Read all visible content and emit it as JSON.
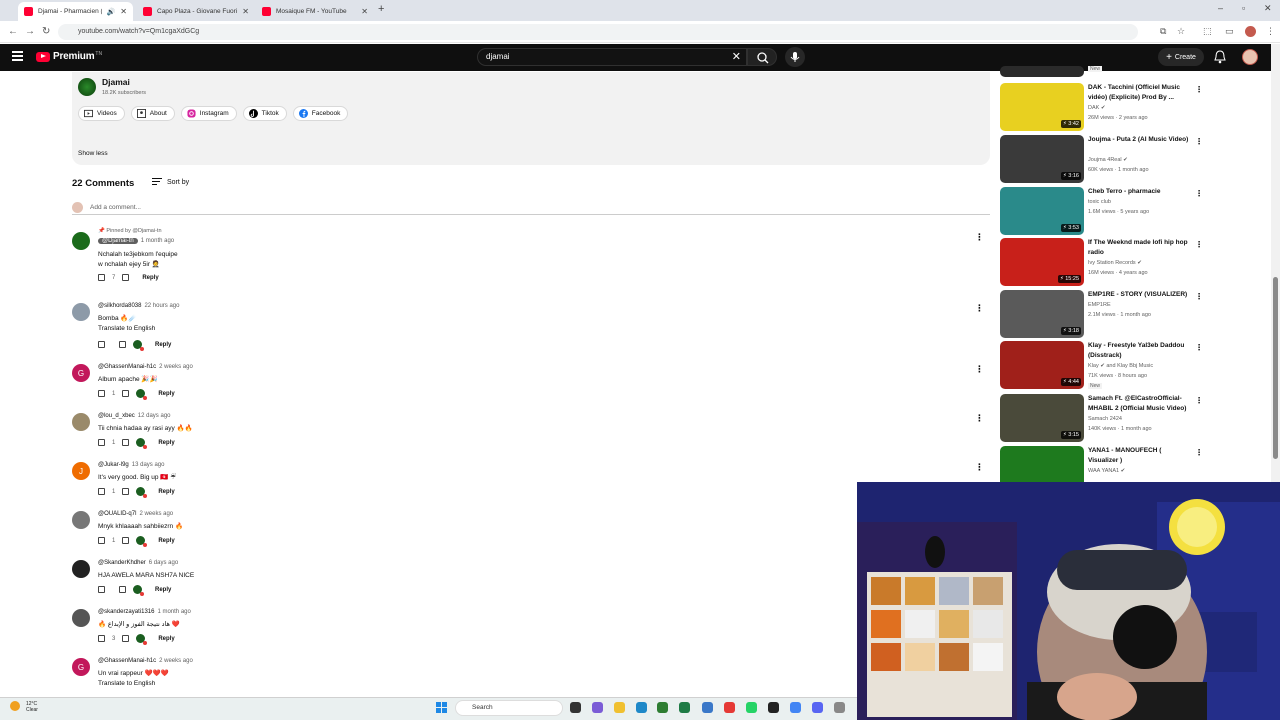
{
  "browser": {
    "tabs": [
      {
        "title": "Djamai - Pharmacien (Lyrics"
      },
      {
        "title": "Capo Plaza - Giovane Fuoriclas"
      },
      {
        "title": "Mosaique FM - YouTube"
      }
    ],
    "url": "youtube.com/watch?v=Qm1cgaXdGCg"
  },
  "header": {
    "logo": "Premium",
    "logo_sup": "TN",
    "search_value": "djamai",
    "create_label": "Create"
  },
  "description": {
    "channel": "Djamai",
    "subscribers": "18.2K subscribers",
    "chips": [
      "Videos",
      "About",
      "Instagram",
      "Tiktok",
      "Facebook"
    ],
    "show_less": "Show less"
  },
  "comments_section": {
    "count_label": "22 Comments",
    "sort_label": "Sort by",
    "add_placeholder": "Add a comment..."
  },
  "comments": [
    {
      "pinned": "Pinned by @Djamai-tn",
      "author": "@Djamai-tn",
      "age": "1 month ago",
      "text": "Nchalah te3jebkom l'equipe\nw nchalah ejey 5ir 🤵",
      "likes": "7",
      "reply": "Reply",
      "avatar": "",
      "avatar_color": "#1b6b1b"
    },
    {
      "author": "@silkhorda8038",
      "age": "22 hours ago",
      "text": "Bomba 🔥☄️",
      "translate": "Translate to English",
      "likes": "",
      "reply": "Reply",
      "avatar": "",
      "avatar_color": "#8d9aa8"
    },
    {
      "author": "@GhassenManai-h1c",
      "age": "2 weeks ago",
      "text": "Album apache 🎉🎉",
      "likes": "1",
      "reply": "Reply",
      "avatar": "G",
      "avatar_color": "#c2185b"
    },
    {
      "author": "@lou_d_xbec",
      "age": "12 days ago",
      "text": "Tii chnia hadaa ay rasi ayy 🔥🔥",
      "likes": "1",
      "reply": "Reply",
      "avatar": "",
      "avatar_color": "#9a8a6a"
    },
    {
      "author": "@Jukar-l9g",
      "age": "13 days ago",
      "text": "It's very good. Big up 🇹🇳 ☔",
      "likes": "1",
      "reply": "Reply",
      "avatar": "J",
      "avatar_color": "#ef6c00"
    },
    {
      "author": "@OUALID-q7l",
      "age": "2 weeks ago",
      "text": "Mnyk khlaaaah sahbiiezrn 🔥",
      "likes": "1",
      "reply": "Reply",
      "avatar": "",
      "avatar_color": "#777"
    },
    {
      "author": "@SkanderKhdher",
      "age": "6 days ago",
      "text": "HJA AWELA MARA NSH7A NICE",
      "likes": "",
      "reply": "Reply",
      "avatar": "",
      "avatar_color": "#222"
    },
    {
      "author": "@skanderzayati1316",
      "age": "1 month ago",
      "text": "🔥 هاد نتيجة الفوز و الإبداع ❤️",
      "likes": "3",
      "reply": "Reply",
      "avatar": "",
      "avatar_color": "#555"
    },
    {
      "author": "@GhassenManai-h1c",
      "age": "2 weeks ago",
      "text": "Un vrai rappeur ❤️❤️❤️",
      "translate": "Translate to English",
      "avatar": "G",
      "avatar_color": "#c2185b"
    }
  ],
  "sidebar": [
    {
      "title": "",
      "channel": "",
      "meta": "",
      "badge": "New",
      "duration": "",
      "thumb": "#2a2a2a"
    },
    {
      "title": "DAK - Tacchini (Officiel Music vidéo) (Explicite) Prod By ...",
      "channel": "DAK ✔",
      "meta": "26M views · 2 years ago",
      "duration": "3:42",
      "thumb": "#e8d020"
    },
    {
      "title": "Joujma - Puta 2 (AI Music Video)",
      "channel": "Joujma 4Real ✔",
      "meta": "60K views · 1 month ago",
      "duration": "3:16",
      "thumb": "#3a3a3a"
    },
    {
      "title": "Cheb Terro - pharmacie",
      "channel": "toxic club",
      "meta": "1.6M views · 5 years ago",
      "duration": "3:53",
      "thumb": "#2a8a8a"
    },
    {
      "title": "If The Weeknd made lofi hip hop radio",
      "channel": "Ivy Station Records ✔",
      "meta": "16M views · 4 years ago",
      "duration": "15:25",
      "thumb": "#c8201a"
    },
    {
      "title": "EMP1RE - STORY (VISUALIZER)",
      "channel": "EMP1RE",
      "meta": "2.1M views · 1 month ago",
      "duration": "3:18",
      "thumb": "#5a5a5a"
    },
    {
      "title": "Klay - Freestyle Yal3eb Daddou (Disstrack)",
      "channel": "Klay ✔ and Klay Bbj Music",
      "meta": "71K views · 8 hours ago",
      "badge": "New",
      "duration": "4:44",
      "thumb": "#a0201a"
    },
    {
      "title": "Samach Ft. @ElCastroOfficial- MHABIL 2 (Official Music Video)",
      "channel": "Samach 2424",
      "meta": "140K views · 1 month ago",
      "duration": "3:15",
      "thumb": "#4a4a3a"
    },
    {
      "title": "YANA1 - MANOUFECH ( Visualizer )",
      "channel": "WAA YANA1 ✔",
      "meta": "",
      "duration": "",
      "thumb": "#1e7a1e"
    }
  ],
  "taskbar": {
    "temp": "12°C",
    "weather": "Clear",
    "search": "Search"
  }
}
